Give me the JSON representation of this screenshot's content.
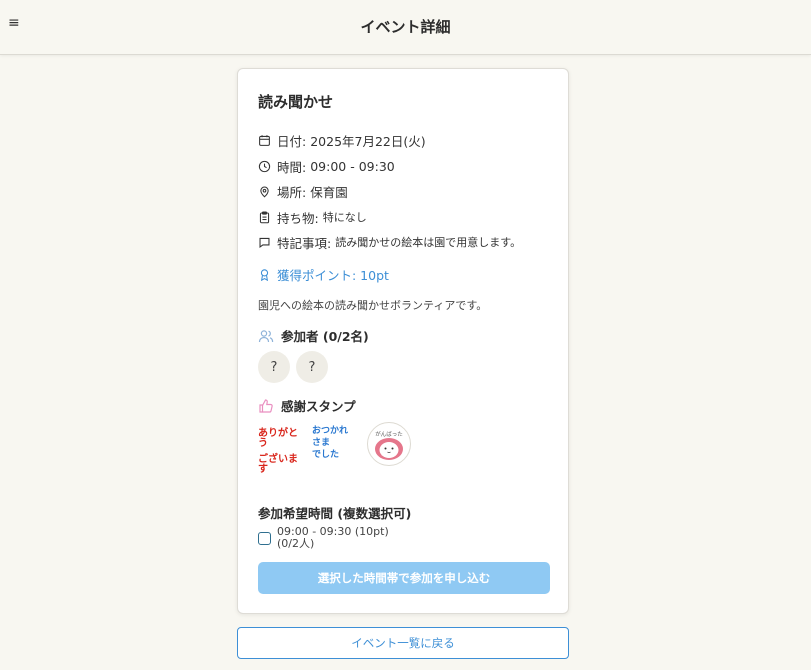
{
  "header": {
    "menu_icon": "≡",
    "title": "イベント詳細"
  },
  "event": {
    "title": "読み聞かせ",
    "date_label": "日付:",
    "date_value": "2025年7月22日(火)",
    "time_label": "時間:",
    "time_value": "09:00 - 09:30",
    "place_label": "場所:",
    "place_value": "保育園",
    "items_label": "持ち物:",
    "items_value": "特になし",
    "notes_label": "特記事項:",
    "notes_value": "読み聞かせの絵本は園で用意します。",
    "points": "獲得ポイント: 10pt",
    "description": "園児への絵本の読み聞かせボランティアです。"
  },
  "participants": {
    "heading": "参加者 (0/2名)",
    "slots": [
      "?",
      "?"
    ]
  },
  "stamps": {
    "heading": "感謝スタンプ",
    "items": [
      {
        "line1": "ありがとう",
        "line2": "ございます"
      },
      {
        "line1": "おつかれ",
        "line2": "さま",
        "line3": "でした"
      },
      {
        "line1": "がんばった"
      }
    ]
  },
  "time_selection": {
    "heading": "参加希望時間 (複数選択可)",
    "slot_line1": "09:00 - 09:30 (10pt)",
    "slot_line2": "(0/2人)",
    "checked": false
  },
  "actions": {
    "apply_label": "選択した時間帯で参加を申し込む",
    "back_label": "イベント一覧に戻る"
  },
  "colors": {
    "accent": "#3d8fd6",
    "apply_disabled": "#8fc9f3",
    "background": "#f8f7f1",
    "stamp_red": "#d9261c",
    "stamp_blue": "#2a78d0"
  }
}
